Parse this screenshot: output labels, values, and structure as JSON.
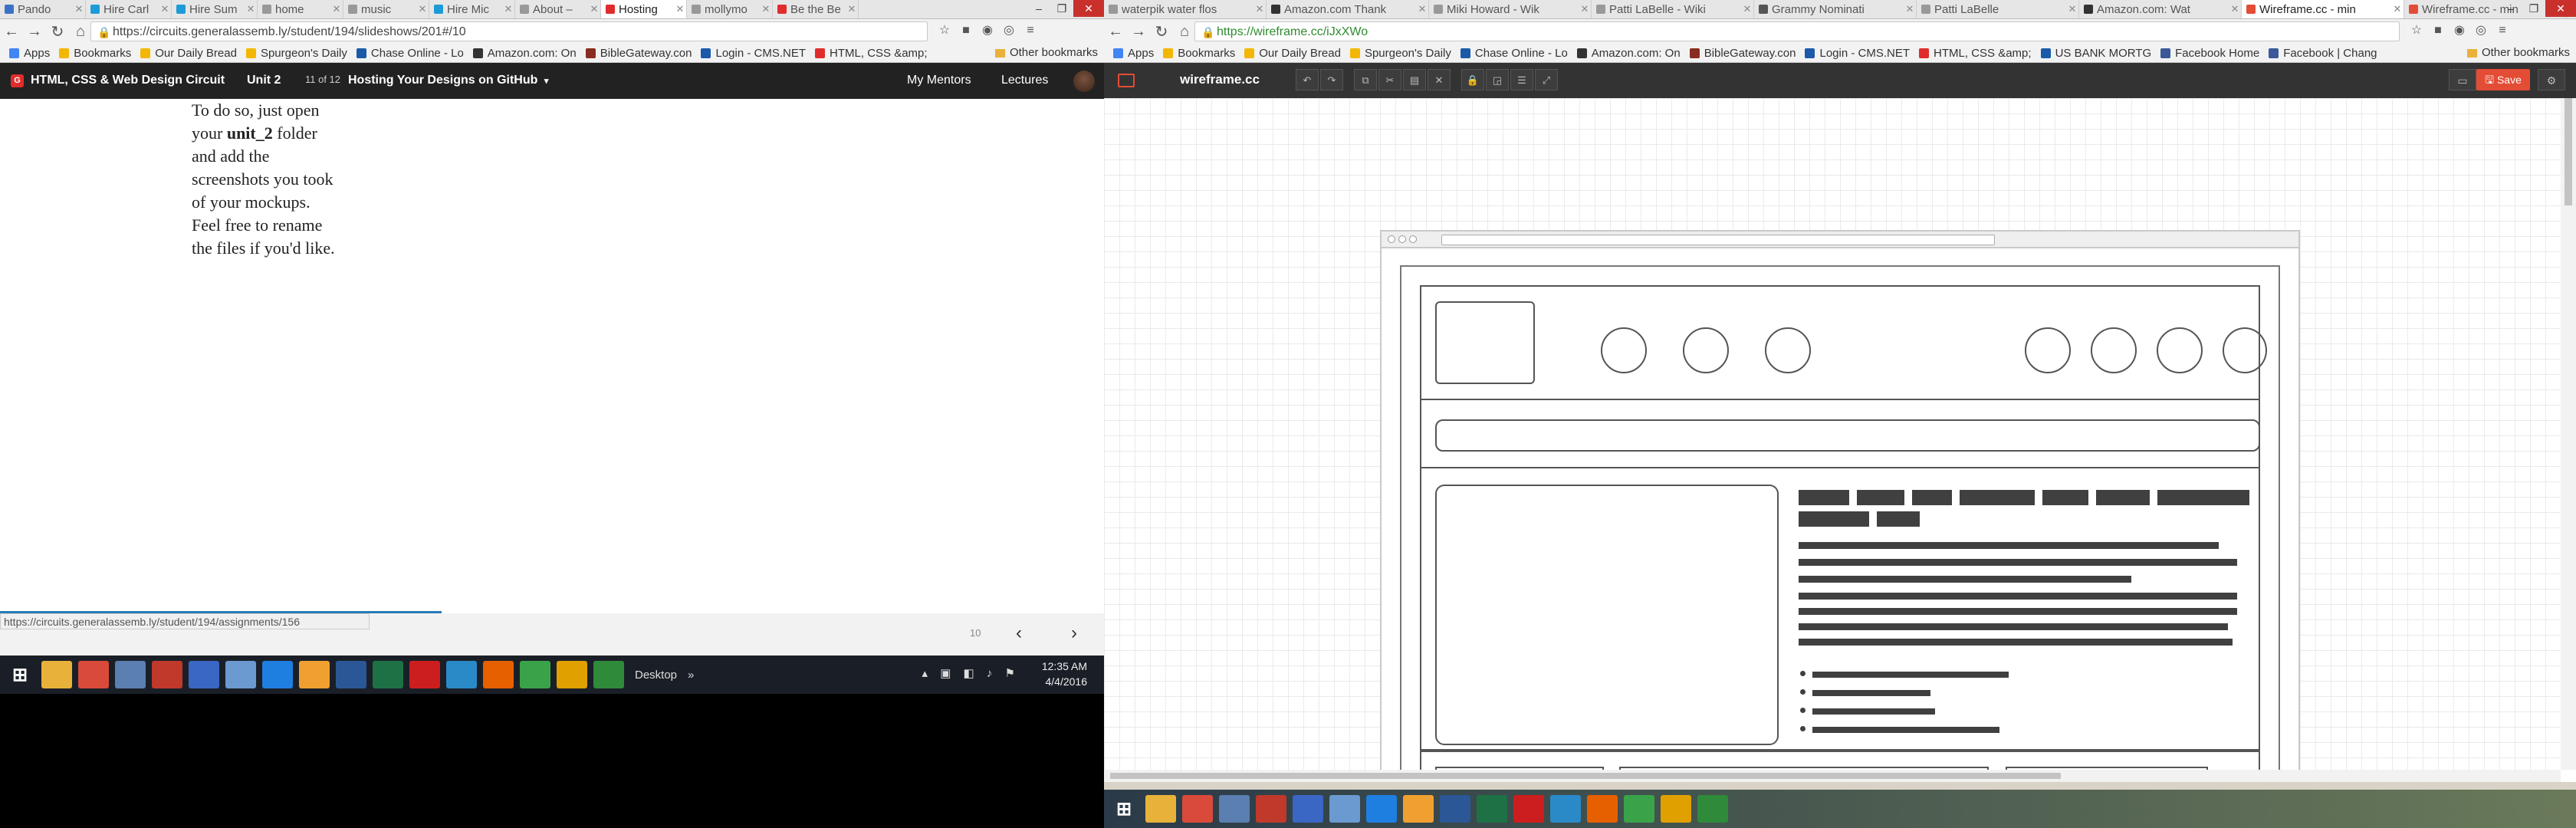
{
  "left_window": {
    "tabs": [
      {
        "label": "Pando",
        "color": "#3b72c4"
      },
      {
        "label": "Hire Carl",
        "color": "#1c9bd7"
      },
      {
        "label": "Hire Sum",
        "color": "#1c9bd7"
      },
      {
        "label": "home",
        "color": "#999999"
      },
      {
        "label": "music",
        "color": "#999999"
      },
      {
        "label": "Hire Mic",
        "color": "#1c9bd7"
      },
      {
        "label": "About –",
        "color": "#999999"
      },
      {
        "label": "Hosting",
        "color": "#e12c2c"
      },
      {
        "label": "mollymo",
        "color": "#999999"
      },
      {
        "label": "Be the Be",
        "color": "#e12c2c"
      }
    ],
    "url": "https://circuits.generalassemb.ly/student/194/slideshows/201#/10",
    "bookmarks": [
      {
        "label": "Apps",
        "color": "#4285f4"
      },
      {
        "label": "Bookmarks",
        "color": "#f2b705"
      },
      {
        "label": "Our Daily Bread",
        "color": "#f2b705"
      },
      {
        "label": "Spurgeon's Daily",
        "color": "#f2b705"
      },
      {
        "label": "Chase Online - Lo",
        "color": "#1a5aa8"
      },
      {
        "label": "Amazon.com: On",
        "color": "#333333"
      },
      {
        "label": "BibleGateway.con",
        "color": "#8a2b1f"
      },
      {
        "label": "Login - CMS.NET",
        "color": "#1a5aa8"
      },
      {
        "label": "HTML, CSS &amp;",
        "color": "#e12c2c"
      }
    ],
    "other_bookmarks": "Other bookmarks",
    "app": {
      "course": "HTML, CSS & Web Design Circuit",
      "unit": "Unit 2",
      "count": "11 of 12",
      "title": "Hosting Your Designs on GitHub",
      "mentors": "My Mentors",
      "lectures": "Lectures"
    },
    "slide": {
      "line1": "To do so, just open",
      "line2a": "your ",
      "line2b": "unit_2",
      "line2c": " folder",
      "line3": "and add the",
      "line4": "screenshots you took",
      "line5": "of your mockups.",
      "line6": "Feel free to rename",
      "line7": "the files if you'd like."
    },
    "status_url": "https://circuits.generalassemb.ly/student/194/assignments/156",
    "page_number": "10",
    "progress_fraction": 0.4
  },
  "left_taskbar": {
    "icons": [
      {
        "name": "folder",
        "color": "#e8b23a"
      },
      {
        "name": "chrome",
        "color": "#d94a3a"
      },
      {
        "name": "calculator",
        "color": "#5a7fb0"
      },
      {
        "name": "quicken",
        "color": "#c0392b"
      },
      {
        "name": "app",
        "color": "#3a66c4"
      },
      {
        "name": "photos",
        "color": "#6a9ad0"
      },
      {
        "name": "dropbox",
        "color": "#1f7fe0"
      },
      {
        "name": "media",
        "color": "#f0a030"
      },
      {
        "name": "word",
        "color": "#2b5797"
      },
      {
        "name": "excel",
        "color": "#1e7145"
      },
      {
        "name": "opera",
        "color": "#cc1e1e"
      },
      {
        "name": "kodi",
        "color": "#2a8ac8"
      },
      {
        "name": "firefox",
        "color": "#e66000"
      },
      {
        "name": "evernote",
        "color": "#3aa34a"
      },
      {
        "name": "keepass",
        "color": "#e0a000"
      },
      {
        "name": "evernote2",
        "color": "#2f8a3a"
      }
    ],
    "desktop": "Desktop",
    "time": "12:35 AM",
    "date": "4/4/2016"
  },
  "right_window": {
    "tabs": [
      {
        "label": "waterpik water flos",
        "color": "#999999"
      },
      {
        "label": "Amazon.com Thank",
        "color": "#333333"
      },
      {
        "label": "Miki Howard - Wik",
        "color": "#999999"
      },
      {
        "label": "Patti LaBelle - Wiki",
        "color": "#999999"
      },
      {
        "label": "Grammy Nominati",
        "color": "#555555"
      },
      {
        "label": "Patti LaBelle",
        "color": "#999999"
      },
      {
        "label": "Amazon.com: Wat",
        "color": "#333333"
      },
      {
        "label": "Wireframe.cc - min",
        "color": "#e34c35"
      },
      {
        "label": "Wireframe.cc - min",
        "color": "#e34c35"
      }
    ],
    "url": "https://wireframe.cc/iJxXWo",
    "bookmarks": [
      {
        "label": "Apps",
        "color": "#4285f4"
      },
      {
        "label": "Bookmarks",
        "color": "#f2b705"
      },
      {
        "label": "Our Daily Bread",
        "color": "#f2b705"
      },
      {
        "label": "Spurgeon's Daily",
        "color": "#f2b705"
      },
      {
        "label": "Chase Online - Lo",
        "color": "#1a5aa8"
      },
      {
        "label": "Amazon.com: On",
        "color": "#333333"
      },
      {
        "label": "BibleGateway.con",
        "color": "#8a2b1f"
      },
      {
        "label": "Login - CMS.NET",
        "color": "#1a5aa8"
      },
      {
        "label": "HTML, CSS &amp;",
        "color": "#e12c2c"
      },
      {
        "label": "US BANK MORTG",
        "color": "#1a5aa8"
      },
      {
        "label": "Facebook Home",
        "color": "#3b5998"
      },
      {
        "label": "Facebook | Chang",
        "color": "#3b5998"
      }
    ],
    "other_bookmarks": "Other bookmarks",
    "app": {
      "name": "wireframe.cc",
      "save": "Save"
    }
  },
  "right_taskbar": {
    "icons": [
      {
        "name": "folder",
        "color": "#e8b23a"
      },
      {
        "name": "chrome",
        "color": "#d94a3a"
      },
      {
        "name": "calculator",
        "color": "#5a7fb0"
      },
      {
        "name": "quicken",
        "color": "#c0392b"
      },
      {
        "name": "app",
        "color": "#3a66c4"
      },
      {
        "name": "photos",
        "color": "#6a9ad0"
      },
      {
        "name": "dropbox",
        "color": "#1f7fe0"
      },
      {
        "name": "media",
        "color": "#f0a030"
      },
      {
        "name": "word",
        "color": "#2b5797"
      },
      {
        "name": "excel",
        "color": "#1e7145"
      },
      {
        "name": "opera",
        "color": "#cc1e1e"
      },
      {
        "name": "kodi",
        "color": "#2a8ac8"
      },
      {
        "name": "firefox",
        "color": "#e66000"
      },
      {
        "name": "evernote",
        "color": "#3aa34a"
      },
      {
        "name": "keepass",
        "color": "#e0a000"
      },
      {
        "name": "evernote2",
        "color": "#2f8a3a"
      }
    ]
  }
}
